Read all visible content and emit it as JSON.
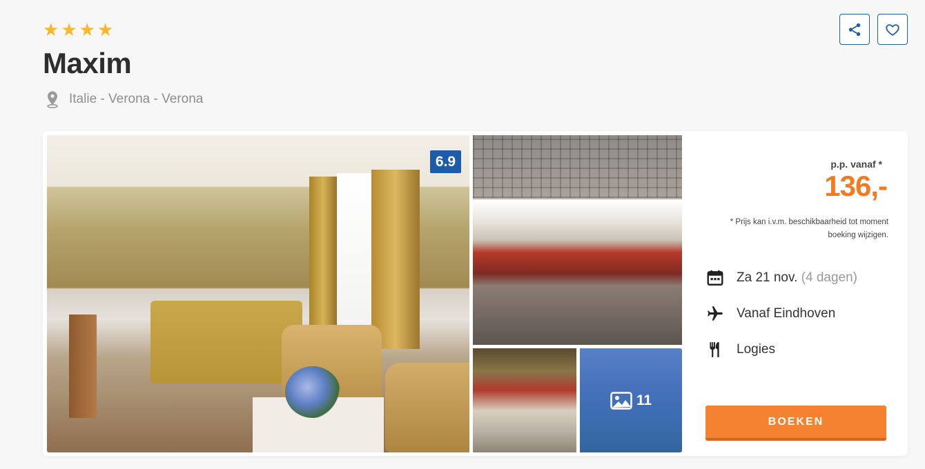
{
  "hotel": {
    "star_count": 4,
    "stars": [
      "★",
      "★",
      "★",
      "★"
    ],
    "name": "Maxim",
    "location": "Italie - Verona - Verona"
  },
  "actions": {
    "share_icon": "share-icon",
    "favorite_icon": "heart-icon"
  },
  "gallery": {
    "rating": "6.9",
    "photo_count": "11",
    "photos": [
      "hotel-room",
      "hotel-bar",
      "hotel-corridor",
      "hotel-exterior"
    ]
  },
  "booking": {
    "price_label": "p.p. vanaf *",
    "price": "136,-",
    "disclaimer": "* Prijs kan i.v.m. beschikbaarheid tot moment boeking wijzigen.",
    "date": "Za 21 nov.",
    "duration": "(4 dagen)",
    "departure": "Vanaf Eindhoven",
    "board": "Logies",
    "book_label": "BOEKEN"
  },
  "colors": {
    "accent_orange": "#f47a20",
    "brand_blue": "#1d5cab",
    "star_yellow": "#f5b82e"
  }
}
